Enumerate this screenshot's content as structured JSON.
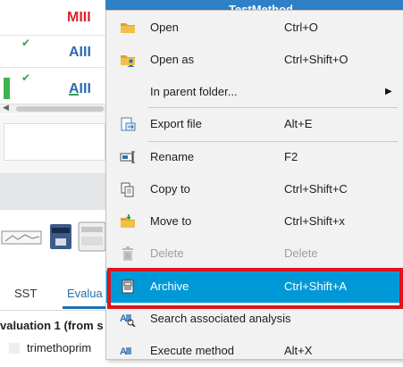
{
  "background": {
    "title": "TestMethod",
    "method_logo_text": "MIII",
    "row_logo_text": "AIII",
    "tabs": [
      {
        "label": "SST"
      },
      {
        "label": "Evalua"
      }
    ],
    "evaluation_label": "valuation 1  (from s",
    "method_item_text": "trimethoprim"
  },
  "menu": {
    "items": [
      {
        "label": "Open",
        "shortcut": "Ctrl+O",
        "icon": "folder-icon"
      },
      {
        "label": "Open as",
        "shortcut": "Ctrl+Shift+O",
        "icon": "folder-user-icon"
      },
      {
        "label": "In parent folder...",
        "shortcut": "",
        "icon": "",
        "submenu": true
      },
      {
        "label": "Export file",
        "shortcut": "Alt+E",
        "icon": "export-file-icon"
      },
      {
        "label": "Rename",
        "shortcut": "F2",
        "icon": "rename-icon"
      },
      {
        "label": "Copy to",
        "shortcut": "Ctrl+Shift+C",
        "icon": "copy-icon"
      },
      {
        "label": "Move to",
        "shortcut": "Ctrl+Shift+x",
        "icon": "move-folder-icon"
      },
      {
        "label": "Delete",
        "shortcut": "Delete",
        "icon": "trash-icon",
        "disabled": true
      },
      {
        "label": "Archive",
        "shortcut": "Ctrl+Shift+A",
        "icon": "archive-icon",
        "highlighted": true
      },
      {
        "label": "Search associated analysis",
        "shortcut": "",
        "icon": "search-analysis-icon"
      },
      {
        "label": "Execute method",
        "shortcut": "Alt+X",
        "icon": "execute-method-icon"
      }
    ]
  },
  "colors": {
    "highlight": "#0099d8",
    "focus_border": "#e0141d",
    "header_blue": "#2f80c6"
  }
}
